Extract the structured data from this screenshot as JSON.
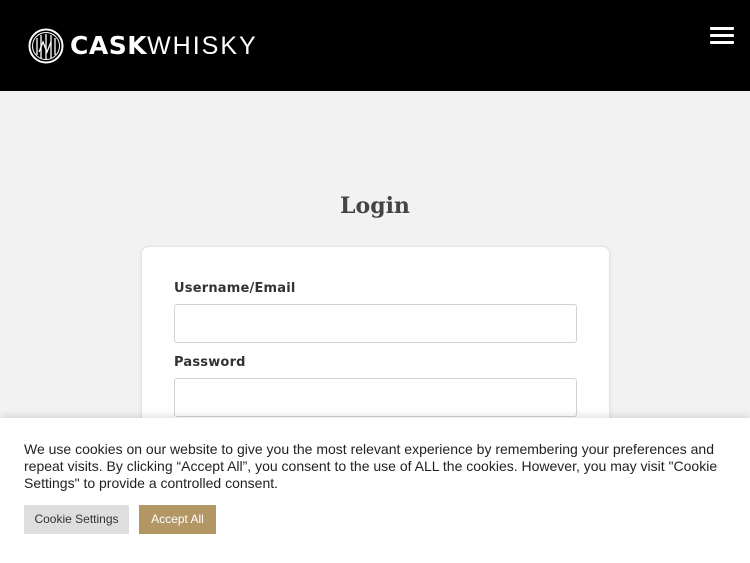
{
  "header": {
    "brand_bold": "CASK",
    "brand_light": "WHISKY",
    "logo_icon": "barrel-logo-icon",
    "menu_icon": "hamburger-menu-icon"
  },
  "main": {
    "title": "Login",
    "username_label": "Username/Email",
    "username_value": "",
    "password_label": "Password",
    "password_value": ""
  },
  "cookie_banner": {
    "text": "We use cookies on our website to give you the most relevant experience by remembering your preferences and repeat visits. By clicking “Accept All”, you consent to the use of ALL the cookies. However, you may visit \"Cookie Settings\" to provide a controlled consent.",
    "settings_label": "Cookie Settings",
    "accept_label": "Accept All"
  },
  "colors": {
    "header_bg": "#000000",
    "accent": "#b29664",
    "page_bg": "#f2f2f2"
  }
}
